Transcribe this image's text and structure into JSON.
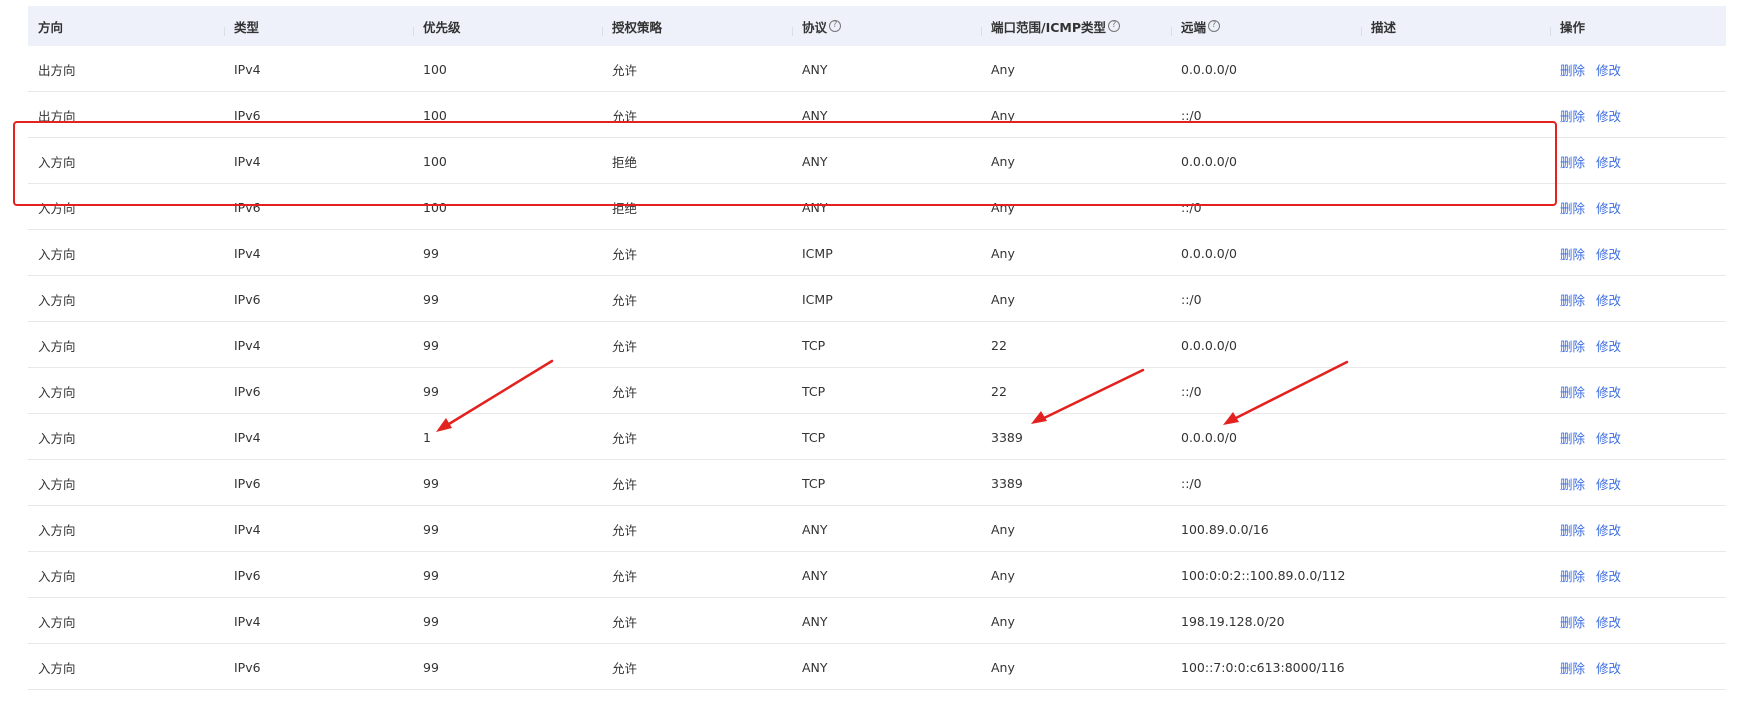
{
  "columns": [
    {
      "label": "方向",
      "help": false
    },
    {
      "label": "类型",
      "help": false
    },
    {
      "label": "优先级",
      "help": false
    },
    {
      "label": "授权策略",
      "help": false
    },
    {
      "label": "协议",
      "help": true
    },
    {
      "label": "端口范围/ICMP类型",
      "help": true
    },
    {
      "label": "远端",
      "help": true
    },
    {
      "label": "描述",
      "help": false
    },
    {
      "label": "操作",
      "help": false
    }
  ],
  "actions": {
    "delete": "删除",
    "edit": "修改"
  },
  "rows": [
    {
      "direction": "出方向",
      "type": "IPv4",
      "priority": "100",
      "policy": "允许",
      "protocol": "ANY",
      "port": "Any",
      "remote": "0.0.0.0/0",
      "description": ""
    },
    {
      "direction": "出方向",
      "type": "IPv6",
      "priority": "100",
      "policy": "允许",
      "protocol": "ANY",
      "port": "Any",
      "remote": "::/0",
      "description": ""
    },
    {
      "direction": "入方向",
      "type": "IPv4",
      "priority": "100",
      "policy": "拒绝",
      "protocol": "ANY",
      "port": "Any",
      "remote": "0.0.0.0/0",
      "description": ""
    },
    {
      "direction": "入方向",
      "type": "IPv6",
      "priority": "100",
      "policy": "拒绝",
      "protocol": "ANY",
      "port": "Any",
      "remote": "::/0",
      "description": ""
    },
    {
      "direction": "入方向",
      "type": "IPv4",
      "priority": "99",
      "policy": "允许",
      "protocol": "ICMP",
      "port": "Any",
      "remote": "0.0.0.0/0",
      "description": ""
    },
    {
      "direction": "入方向",
      "type": "IPv6",
      "priority": "99",
      "policy": "允许",
      "protocol": "ICMP",
      "port": "Any",
      "remote": "::/0",
      "description": ""
    },
    {
      "direction": "入方向",
      "type": "IPv4",
      "priority": "99",
      "policy": "允许",
      "protocol": "TCP",
      "port": "22",
      "remote": "0.0.0.0/0",
      "description": ""
    },
    {
      "direction": "入方向",
      "type": "IPv6",
      "priority": "99",
      "policy": "允许",
      "protocol": "TCP",
      "port": "22",
      "remote": "::/0",
      "description": ""
    },
    {
      "direction": "入方向",
      "type": "IPv4",
      "priority": "1",
      "policy": "允许",
      "protocol": "TCP",
      "port": "3389",
      "remote": "0.0.0.0/0",
      "description": ""
    },
    {
      "direction": "入方向",
      "type": "IPv6",
      "priority": "99",
      "policy": "允许",
      "protocol": "TCP",
      "port": "3389",
      "remote": "::/0",
      "description": ""
    },
    {
      "direction": "入方向",
      "type": "IPv4",
      "priority": "99",
      "policy": "允许",
      "protocol": "ANY",
      "port": "Any",
      "remote": "100.89.0.0/16",
      "description": ""
    },
    {
      "direction": "入方向",
      "type": "IPv6",
      "priority": "99",
      "policy": "允许",
      "protocol": "ANY",
      "port": "Any",
      "remote": "100:0:0:2::100.89.0.0/112",
      "description": ""
    },
    {
      "direction": "入方向",
      "type": "IPv4",
      "priority": "99",
      "policy": "允许",
      "protocol": "ANY",
      "port": "Any",
      "remote": "198.19.128.0/20",
      "description": ""
    },
    {
      "direction": "入方向",
      "type": "IPv6",
      "priority": "99",
      "policy": "允许",
      "protocol": "ANY",
      "port": "Any",
      "remote": "100::7:0:0:c613:8000/116",
      "description": ""
    }
  ],
  "annotation_color": "#e3211f",
  "link_color": "#3b6ce0",
  "header_bg": "#eef1fa"
}
